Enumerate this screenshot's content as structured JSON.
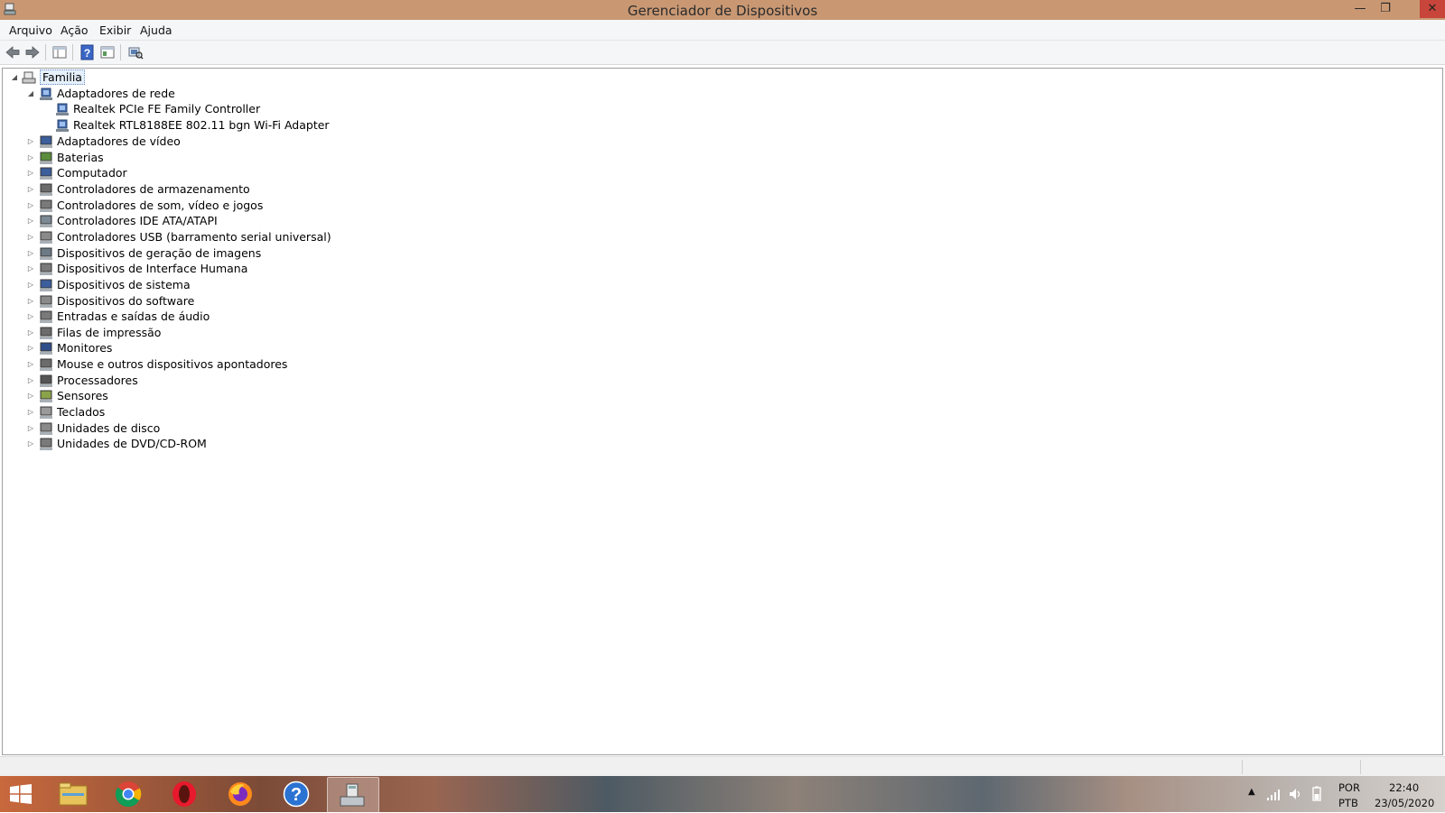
{
  "window": {
    "title": "Gerenciador de Dispositivos"
  },
  "menu": {
    "items": [
      "Arquivo",
      "Ação",
      "Exibir",
      "Ajuda"
    ]
  },
  "toolbar": {
    "icons": [
      "back-arrow-icon",
      "forward-arrow-icon",
      "properties-pane-icon",
      "help-icon",
      "device-view-icon",
      "scan-hardware-icon"
    ]
  },
  "tree": {
    "root": "Familia",
    "network_category": "Adaptadores de rede",
    "network_children": [
      "Realtek PCIe FE Family Controller",
      "Realtek RTL8188EE 802.11 bgn Wi-Fi Adapter"
    ],
    "categories": [
      "Adaptadores de vídeo",
      "Baterias",
      "Computador",
      "Controladores de armazenamento",
      "Controladores de som, vídeo e jogos",
      "Controladores IDE ATA/ATAPI",
      "Controladores USB (barramento serial universal)",
      "Dispositivos de geração de imagens",
      "Dispositivos de Interface Humana",
      "Dispositivos de sistema",
      "Dispositivos do software",
      "Entradas e saídas de áudio",
      "Filas de impressão",
      "Monitores",
      "Mouse e outros dispositivos apontadores",
      "Processadores",
      "Sensores",
      "Teclados",
      "Unidades de disco",
      "Unidades de DVD/CD-ROM"
    ]
  },
  "taskbar": {
    "apps": [
      "windows-start-icon",
      "file-explorer-icon",
      "chrome-icon",
      "opera-icon",
      "firefox-icon",
      "help-icon",
      "device-manager-icon"
    ],
    "tray": {
      "lang_top": "POR",
      "lang_bottom": "PTB",
      "time": "22:40",
      "date": "23/05/2020"
    }
  },
  "colors": {
    "titlebar": "#c99873",
    "close_button": "#c7453a",
    "selection": "#e5f0fb"
  }
}
